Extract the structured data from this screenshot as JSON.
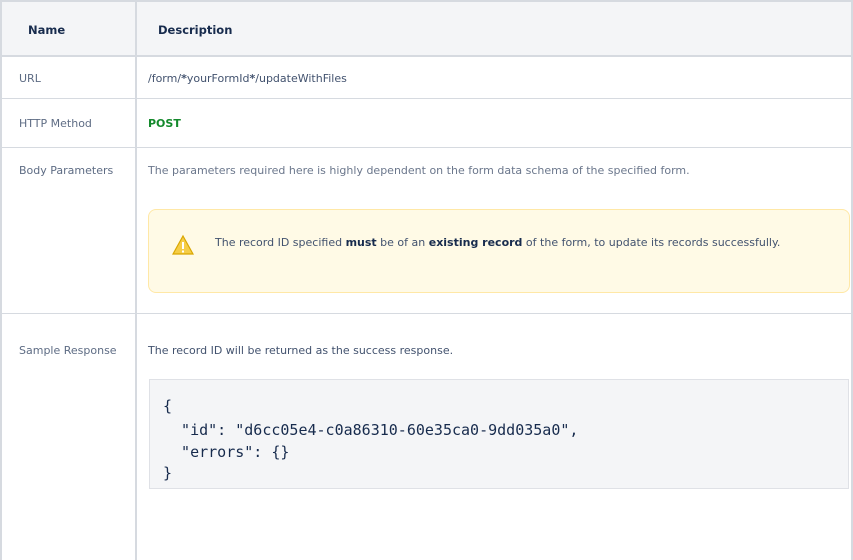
{
  "header": {
    "name_col": "Name",
    "desc_col": "Description"
  },
  "rows": {
    "url": {
      "name": "URL",
      "value_prefix": "/form/",
      "value_mid": "yourFormId",
      "value_suffix": "/updateWithFiles",
      "star": "*"
    },
    "method": {
      "name": "HTTP Method",
      "value": "POST"
    },
    "body": {
      "name": "Body Parameters",
      "value": "The parameters required here is highly dependent on the form data schema of the specified form.",
      "warning": {
        "icon": "warning-icon",
        "text_1": "The record ID specified ",
        "bold_1": "must",
        "text_2": " be of an ",
        "bold_2": "existing record",
        "text_3": " of the form, to update its records successfully."
      }
    },
    "response": {
      "name": "Sample Response",
      "value": "The record ID will be returned as the success response.",
      "code": {
        "line1": "{",
        "line2": "  \"id\": \"d6cc05e4-c0a86310-60e35ca0-9dd035a0\",",
        "line3": "  \"errors\": {}",
        "line4": "}"
      }
    }
  },
  "colors": {
    "post": "#14892c",
    "warning_bg": "#fffae6",
    "warning_icon": "#f5cd47"
  }
}
